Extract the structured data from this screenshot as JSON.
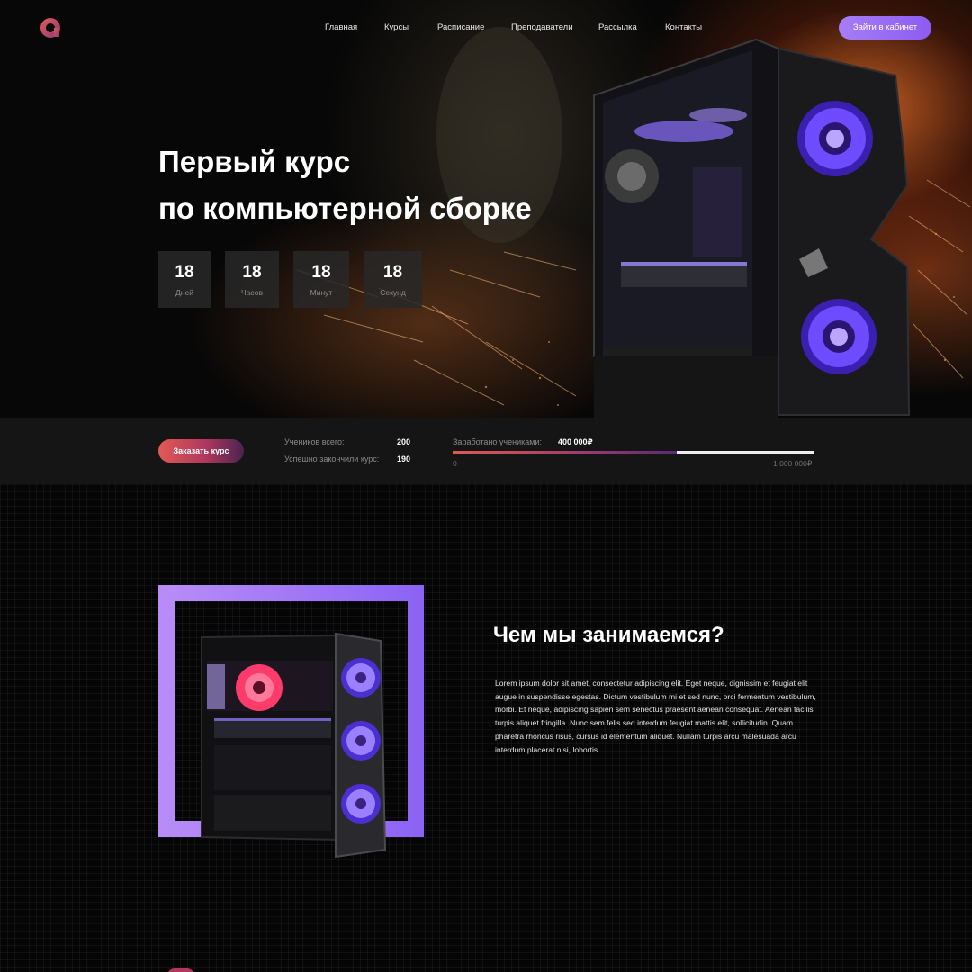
{
  "header": {
    "nav": [
      "Главная",
      "Курсы",
      "Расписание",
      "Преподаватели",
      "Рассылка",
      "Контакты"
    ],
    "cabinet_button": "Зайти в кабинет",
    "logo_icon": "logo-ring-icon"
  },
  "hero": {
    "title_line1": "Первый курс",
    "title_line2": "по компьютерной сборке",
    "counters": [
      {
        "value": "18",
        "label": "Дней"
      },
      {
        "value": "18",
        "label": "Часов"
      },
      {
        "value": "18",
        "label": "Минут"
      },
      {
        "value": "18",
        "label": "Секунд"
      }
    ]
  },
  "stats": {
    "order_button": "Заказать курс",
    "students_label": "Учеников всего:",
    "students_value": "200",
    "finished_label": "Успешно закончили курс:",
    "finished_value": "190",
    "earned_label": "Заработано учениками:",
    "earned_value": "400 000₽",
    "range_min": "0",
    "range_max": "1 000 000₽",
    "earned_fraction": 0.62
  },
  "about": {
    "title": "Чем мы занимаемся?",
    "text": "Lorem ipsum dolor sit amet, consectetur adipiscing elit. Eget neque, dignissim et feugiat elit augue in suspendisse egestas. Dictum vestibulum mi et sed nunc, orci fermentum vestibulum, morbi. Et neque, adipiscing sapien sem senectus praesent aenean consequat. Aenean facilisi turpis aliquet fringilla. Nunc sem felis sed interdum feugiat mattis elit, sollicitudin. Quam pharetra rhoncus risus, cursus id elementum aliquet. Nullam turpis arcu malesuada arcu interdum placerat nisi, lobortis."
  },
  "colors": {
    "accent_purple": "#9b6ef5",
    "accent_red": "#e25a55",
    "background": "#000000",
    "stats_bg": "#151515"
  }
}
